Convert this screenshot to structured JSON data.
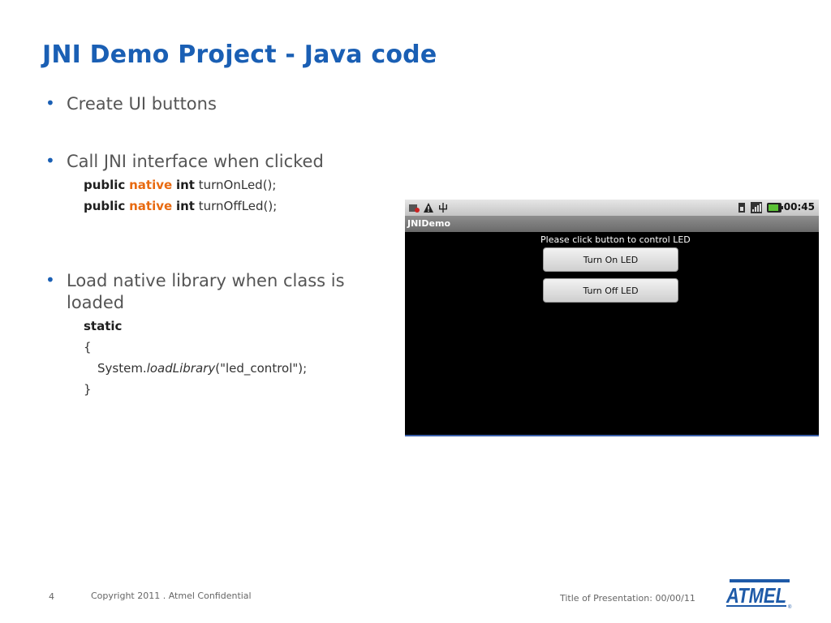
{
  "slide": {
    "title": "JNI Demo Project - Java code",
    "bullets": [
      "Create UI buttons",
      "Call JNI interface when clicked",
      "Load native library when class is loaded"
    ],
    "code1": {
      "line1": {
        "k1": "public",
        "k2": "native",
        "k3": "int",
        "rest": "turnOnLed();"
      },
      "line2": {
        "k1": "public",
        "k2": "native",
        "k3": "int",
        "rest": "turnOffLed();"
      }
    },
    "code2": {
      "static": "static",
      "open": "{",
      "call_prefix": "System.",
      "call_method": "loadLibrary",
      "call_args": "(\"led_control\");",
      "close": "}"
    }
  },
  "phone": {
    "clock": "00:45",
    "app_title": "JNIDemo",
    "prompt": "Please click button to control LED",
    "btn_on": "Turn On LED",
    "btn_off": "Turn Off LED",
    "status_icons_left": [
      "sd-card-icon",
      "warning-icon",
      "usb-icon"
    ],
    "status_icons_right": [
      "sim-icon",
      "signal-icon",
      "battery-icon"
    ]
  },
  "footer": {
    "page_number": "4",
    "copyright": "Copyright 2011 . Atmel Confidential",
    "presentation": "Title of Presentation: 00/00/11",
    "logo_text": "ATMEL",
    "registered": "®"
  },
  "colors": {
    "title": "#1a5fb4",
    "keyword_native": "#e86a10",
    "bullet_dot": "#1a5fb4"
  }
}
